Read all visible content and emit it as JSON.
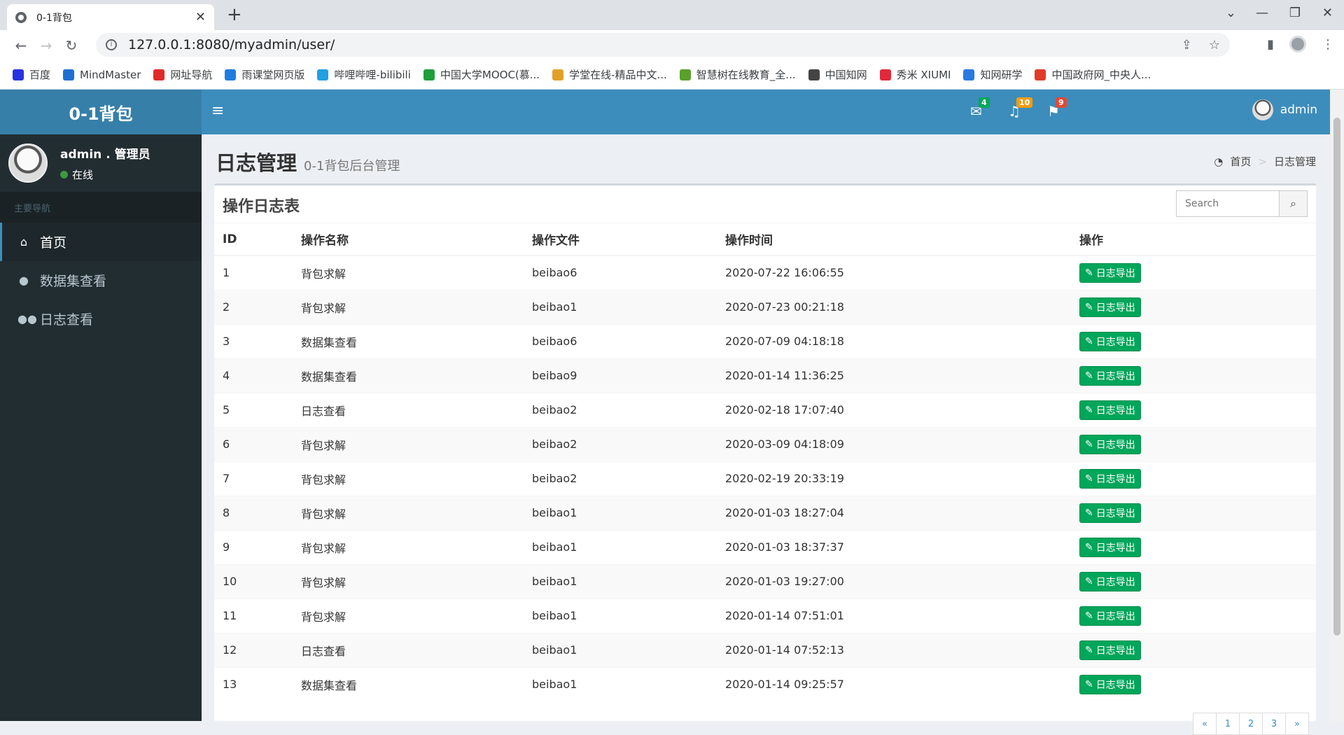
{
  "browser": {
    "tab_title": "0-1背包",
    "url": "127.0.0.1:8080/myadmin/user/",
    "bookmarks": [
      "百度",
      "MindMaster",
      "网址导航",
      "雨课堂网页版",
      "哔哩哔哩-bilibili",
      "中国大学MOOC(慕...",
      "学堂在线-精品中文...",
      "智慧树在线教育_全...",
      "中国知网",
      "秀米 XIUMI",
      "知网研学",
      "中国政府网_中央人..."
    ],
    "bookmark_colors": [
      "#2932e1",
      "#1f6fd1",
      "#e12929",
      "#1f7de1",
      "#22a0e1",
      "#1f9e3a",
      "#e1a129",
      "#5aa02c",
      "#444444",
      "#e1293b",
      "#2979e1",
      "#e13b29"
    ]
  },
  "app": {
    "logo": "0-1背包",
    "user": {
      "name": "admin . 管理员",
      "status": "在线"
    },
    "nav_header": "主要导航",
    "nav": [
      {
        "label": "首页",
        "icon": "home-icon"
      },
      {
        "label": "数据集查看",
        "icon": "user-icon"
      },
      {
        "label": "日志查看",
        "icon": "users-icon"
      }
    ],
    "topbar": {
      "mail_count": "4",
      "bell_count": "10",
      "flag_count": "9",
      "username": "admin"
    }
  },
  "page": {
    "title": "日志管理",
    "subtitle": "0-1背包后台管理",
    "breadcrumb": [
      "首页",
      "日志管理"
    ]
  },
  "box": {
    "title": "操作日志表",
    "search_placeholder": "Search"
  },
  "table": {
    "headers": [
      "ID",
      "操作名称",
      "操作文件",
      "操作时间",
      "操作"
    ],
    "action_label": "日志导出",
    "rows": [
      [
        "1",
        "背包求解",
        "beibao6",
        "2020-07-22 16:06:55"
      ],
      [
        "2",
        "背包求解",
        "beibao1",
        "2020-07-23 00:21:18"
      ],
      [
        "3",
        "数据集查看",
        "beibao6",
        "2020-07-09 04:18:18"
      ],
      [
        "4",
        "数据集查看",
        "beibao9",
        "2020-01-14 11:36:25"
      ],
      [
        "5",
        "日志查看",
        "beibao2",
        "2020-02-18 17:07:40"
      ],
      [
        "6",
        "背包求解",
        "beibao2",
        "2020-03-09 04:18:09"
      ],
      [
        "7",
        "背包求解",
        "beibao2",
        "2020-02-19 20:33:19"
      ],
      [
        "8",
        "背包求解",
        "beibao1",
        "2020-01-03 18:27:04"
      ],
      [
        "9",
        "背包求解",
        "beibao1",
        "2020-01-03 18:37:37"
      ],
      [
        "10",
        "背包求解",
        "beibao1",
        "2020-01-03 19:27:00"
      ],
      [
        "11",
        "背包求解",
        "beibao1",
        "2020-01-14 07:51:01"
      ],
      [
        "12",
        "日志查看",
        "beibao1",
        "2020-01-14 07:52:13"
      ],
      [
        "13",
        "数据集查看",
        "beibao1",
        "2020-01-14 09:25:57"
      ]
    ]
  },
  "pagination": [
    "«",
    "1",
    "2",
    "3",
    "»"
  ],
  "colors": {
    "header": "#3c8dbc",
    "logo_bg": "#367fa9",
    "sidebar": "#222d32",
    "success": "#00a65a"
  }
}
